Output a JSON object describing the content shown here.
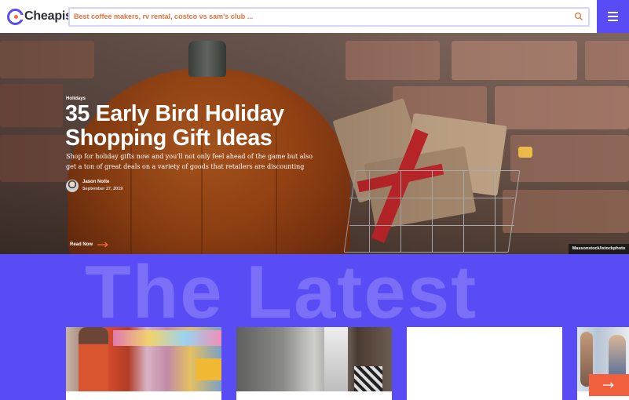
{
  "header": {
    "logo_text": "Cheapism",
    "logo_tm": "™",
    "search_placeholder": "Best coffee makers, rv rental, costco vs sam's club ...",
    "menu_label": "menu"
  },
  "hero": {
    "category": "Holidays",
    "title": "35 Early Bird Holiday Shopping Gift Ideas",
    "dek": "Shop for holiday gifts now and you'll not only feel ahead of the game but also get a ton of great deals on a variety of goods that retailers are discounting",
    "author": "Jason Notte",
    "date": "September 27, 2019",
    "cta": "Read Now",
    "photo_credit": "Massonstock/istockphoto"
  },
  "latest": {
    "heading": "The Latest"
  },
  "colors": {
    "brand": "#5a4cf5",
    "accent": "#f0603f",
    "search_text": "#e8713f"
  }
}
